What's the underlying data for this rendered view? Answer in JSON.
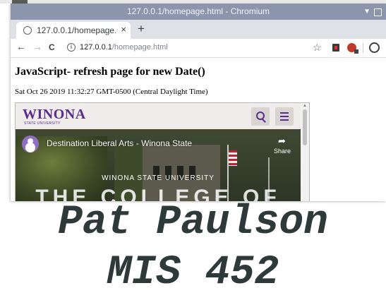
{
  "window": {
    "title": "127.0.0.1/homepage.html - Chromium"
  },
  "tab": {
    "title": "127.0.0.1/homepage.html",
    "close_label": "×",
    "new_tab_label": "+"
  },
  "toolbar": {
    "back": "←",
    "forward": "→",
    "reload": "C",
    "url_host": "127.0.0.1",
    "url_path": "/homepage.html",
    "star": "☆"
  },
  "page": {
    "heading": "JavaScript- refresh page for new Date()",
    "date": "Sat Oct 26 2019 11:32:27 GMT-0500 (Central Daylight Time)"
  },
  "embed": {
    "logo": "WINONA",
    "logo_sub": "STATE UNIVERSITY",
    "video_title": "Destination Liberal Arts - Winona State",
    "share_label": "Share",
    "overlay_text": "WINONA STATE UNIVERSITY",
    "overlay_big": "THE COLLEGE OF",
    "brand_color": "#5b2c8e"
  },
  "caption": {
    "line1": "Pat Paulson",
    "line2": "MIS 452"
  }
}
